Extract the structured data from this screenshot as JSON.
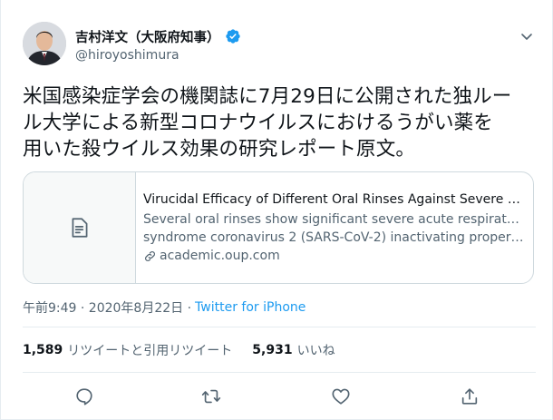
{
  "author": {
    "display_name": "吉村洋文（大阪府知事）",
    "handle": "@hiroyoshimura"
  },
  "tweet": {
    "text_lines": [
      "米国感染症学会の機関誌に7月29日に公開された独ルー",
      "ル大学による新型コロナウイルスにおけるうがい薬を",
      "用いた殺ウイルス効果の研究レポート原文。"
    ]
  },
  "card": {
    "title": "Virucidal Efficacy of Different Oral Rinses Against Severe Acut...",
    "desc_line1": "Several oral rinses show significant severe acute respiratory",
    "desc_line2": "syndrome coronavirus 2 (SARS-CoV-2) inactivating properties ...",
    "domain": "academic.oup.com"
  },
  "meta": {
    "time_date": "午前9:49 · 2020年8月22日 ·",
    "source": "Twitter for iPhone"
  },
  "stats": {
    "retweets_count": "1,589",
    "retweets_label": "リツイートと引用リツイート",
    "likes_count": "5,931",
    "likes_label": "いいね"
  },
  "colors": {
    "accent": "#1d9bf0",
    "secondary_text": "#536471",
    "border": "#e6ecf0"
  },
  "icons": {
    "verified": "verified-badge-icon",
    "caret": "chevron-down-icon",
    "card_thumb": "document-icon",
    "link": "link-icon",
    "reply": "reply-icon",
    "retweet": "retweet-icon",
    "like": "heart-icon",
    "share": "share-icon"
  }
}
